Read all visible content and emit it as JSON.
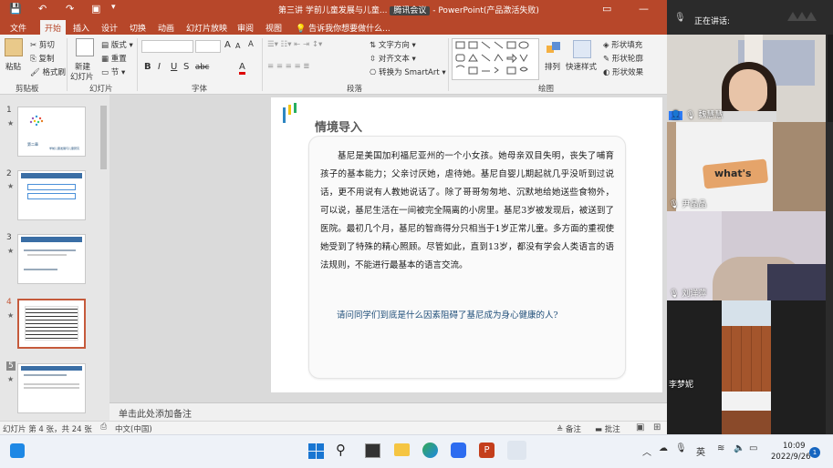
{
  "window": {
    "title": "第三讲 学前儿童发展与儿童...",
    "title_app": "腾讯会议",
    "title_suffix": "PowerPoint(产品激活失败)"
  },
  "ribbon_tabs": [
    "文件",
    "开始",
    "插入",
    "设计",
    "切换",
    "动画",
    "幻灯片放映",
    "审阅",
    "视图"
  ],
  "ribbon_tell_me": "告诉我你想要做什么...",
  "ribbon": {
    "clipboard": {
      "paste": "粘贴",
      "cut": "剪切",
      "copy": "复制",
      "format_painter": "格式刷",
      "label": "剪贴板"
    },
    "slides": {
      "new_slide": "新建",
      "new_slide_2": "幻灯片",
      "layout": "版式",
      "reset": "重置",
      "section": "节",
      "label": "幻灯片"
    },
    "font": {
      "label": "字体",
      "bold": "B",
      "italic": "I",
      "underline": "U",
      "strike": "S",
      "shadow": "abc",
      "grow": "A",
      "shrink": "A",
      "clear": "A",
      "font_color": "A"
    },
    "paragraph": {
      "label": "段落",
      "text_dir": "文字方向",
      "align_text": "对齐文本",
      "smartart": "转换为 SmartArt"
    },
    "drawing": {
      "arrange": "排列",
      "quick_styles": "快速样式",
      "shape_fill": "形状填充",
      "shape_outline": "形状轮廓",
      "shape_effects": "形状效果",
      "label": "绘图"
    }
  },
  "slides": [
    {
      "num": "1",
      "title": "第二章",
      "subtitle": "学前儿童发展与儿童研究"
    },
    {
      "num": "2",
      "title": "第一节 学前儿童的发展与儿童研究"
    },
    {
      "num": "3",
      "title": "第二节 学前儿童的发展与儿童研究"
    },
    {
      "num": "4",
      "title": "情境导入"
    },
    {
      "num": "5",
      "title": "第一节 学前儿童的发展概述"
    }
  ],
  "slide_content": {
    "heading": "情境导入",
    "paragraph": "基尼是美国加利福尼亚州的一个小女孩。她母亲双目失明，丧失了哺育孩子的基本能力；父亲讨厌她，虐待她。基尼自婴儿期起就几乎没听到过说话，更不用说有人教她说话了。除了哥哥匆匆地、沉默地给她送些食物外，可以说，基尼生活在一间被完全隔离的小房里。基尼3岁被发现后，被送到了医院。最初几个月，基尼的智商得分只相当于1岁正常儿童。多方面的重视使她受到了特殊的精心照顾。尽管如此，直到13岁，都没有学会人类语言的语法规则，不能进行最基本的语言交流。",
    "question": "请问同学们到底是什么因素阻碍了基尼成为身心健康的人?"
  },
  "notes_placeholder": "单击此处添加备注",
  "status": {
    "slide_info": "幻灯片 第 4 张，共 24 张",
    "language": "中文(中国)",
    "notes": "备注",
    "comments": "批注"
  },
  "meeting": {
    "speaking_label": "正在讲话:",
    "participants": [
      {
        "name": "魏慧慧"
      },
      {
        "name": "尹晶晶"
      },
      {
        "name": "刘洋萍"
      },
      {
        "name": "李梦妮"
      }
    ],
    "video_text": "what's"
  },
  "taskbar": {
    "ime": "英",
    "time": "10:09",
    "date": "2022/9/26",
    "notification_count": "1"
  },
  "colors": {
    "accent": "#b7472a",
    "slide_heading": "#595959",
    "question": "#1f4e79"
  }
}
